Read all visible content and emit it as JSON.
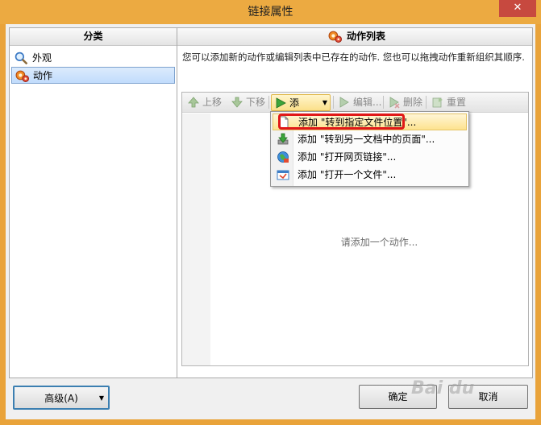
{
  "window": {
    "title": "链接属性",
    "close_label": "✕"
  },
  "categories": {
    "header": "分类",
    "items": [
      {
        "label": "外观",
        "icon": "magnifier-icon",
        "selected": false
      },
      {
        "label": "动作",
        "icon": "gears-icon",
        "selected": true
      }
    ]
  },
  "actions": {
    "header": "动作列表",
    "description": "您可以添加新的动作或编辑列表中已存在的动作. 您也可以拖拽动作重新组织其顺序.",
    "toolbar": {
      "move_up": "上移",
      "move_down": "下移",
      "add": "添加...",
      "edit": "编辑...",
      "delete": "删除",
      "reset": "重置"
    },
    "empty_text": "请添加一个动作..."
  },
  "add_menu": {
    "items": [
      {
        "label": "添加 \"转到指定文件位置\"...",
        "icon": "page-icon"
      },
      {
        "label": "添加 \"转到另一文档中的页面\"...",
        "icon": "download-arrow-icon"
      },
      {
        "label": "添加 \"打开网页链接\"...",
        "icon": "globe-icon"
      },
      {
        "label": "添加 \"打开一个文件\"...",
        "icon": "file-icon"
      }
    ]
  },
  "buttons": {
    "advanced": "高级(A)",
    "ok": "确定",
    "cancel": "取消"
  },
  "watermark": "Bai du"
}
